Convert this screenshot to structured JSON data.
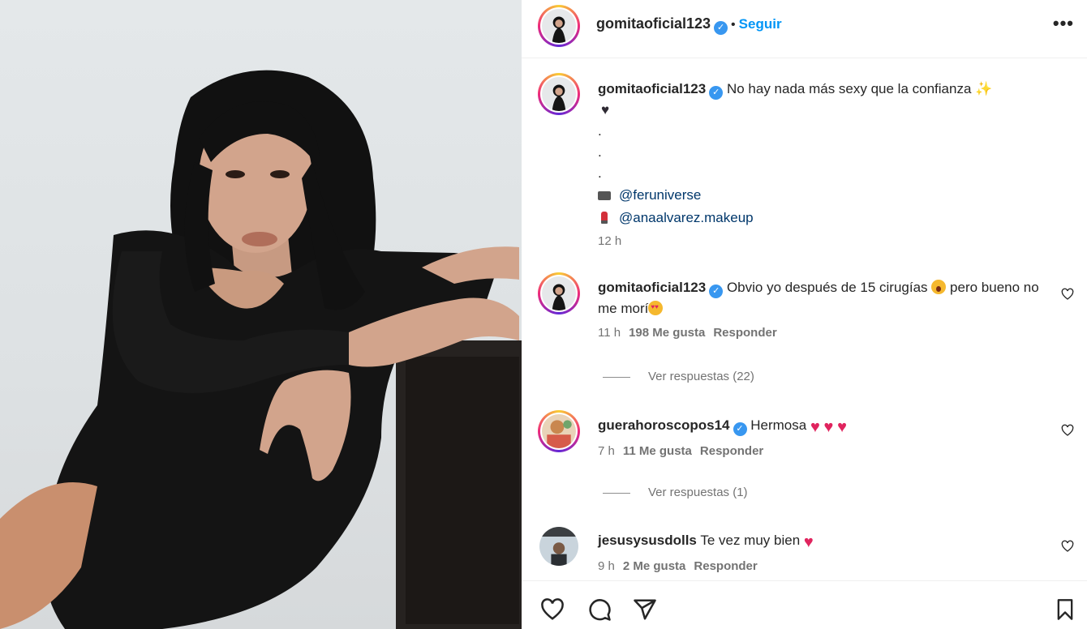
{
  "post": {
    "username": "gomitaoficial123",
    "verified_mark": "✓",
    "dot": "•",
    "follow_label": "Seguir",
    "more_label": "•••"
  },
  "caption": {
    "username": "gomitaoficial123",
    "text": "No hay nada más sexy que la confianza",
    "dots": [
      ".",
      ".",
      "."
    ],
    "credits": [
      {
        "icon": "camera-icon",
        "handle": "@feruniverse"
      },
      {
        "icon": "lipstick-icon",
        "handle": "@anaalvarez.makeup"
      }
    ],
    "time": "12 h"
  },
  "comments": [
    {
      "username": "gomitaoficial123",
      "verified": true,
      "text_a": "Obvio yo después de 15 cirugías",
      "text_b": "pero bueno no me morí",
      "time": "11 h",
      "likes": "198 Me gusta",
      "reply": "Responder",
      "view_replies": "Ver respuestas (22)"
    },
    {
      "username": "guerahoroscopos14",
      "verified": true,
      "text": "Hermosa",
      "time": "7 h",
      "likes": "11 Me gusta",
      "reply": "Responder",
      "view_replies": "Ver respuestas (1)"
    },
    {
      "username": "jesusysusdolls",
      "verified": false,
      "text": "Te vez muy bien",
      "time": "9 h",
      "likes": "2 Me gusta",
      "reply": "Responder"
    }
  ],
  "icons": {
    "action_bar": [
      "heart-icon",
      "comment-icon",
      "share-icon",
      "bookmark-icon"
    ]
  },
  "colors": {
    "link": "#00376b",
    "follow": "#0095f6",
    "verified": "#3897f0",
    "heart_emoji": "#e0245e"
  }
}
